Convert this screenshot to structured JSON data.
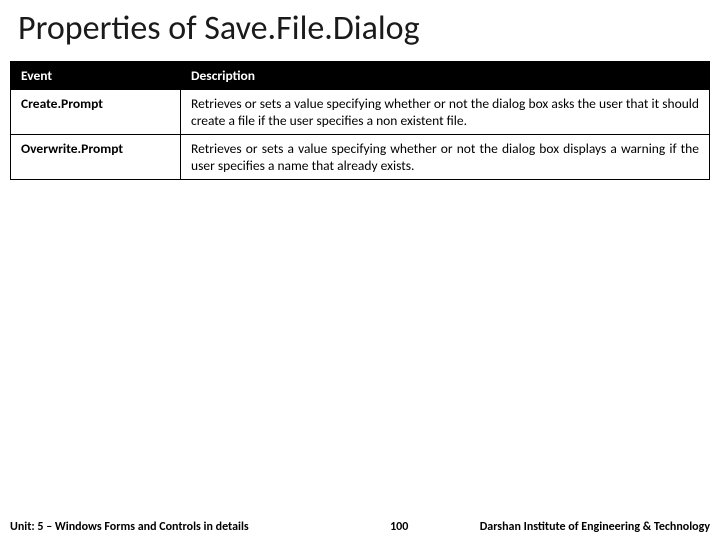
{
  "title": "Properties of Save.File.Dialog",
  "table": {
    "headers": {
      "event": "Event",
      "description": "Description"
    },
    "rows": [
      {
        "property": "Create.Prompt",
        "description": "Retrieves or sets a value specifying whether or not the dialog box asks the user that it should create a file if the user specifies a non existent file."
      },
      {
        "property": "Overwrite.Prompt",
        "description": "Retrieves or sets a value specifying whether or not the dialog box displays a warning if the user specifies a name that already exists."
      }
    ]
  },
  "footer": {
    "unit": "Unit: 5 – Windows Forms and Controls in details",
    "page": "100",
    "institute": "Darshan Institute of Engineering & Technology"
  }
}
